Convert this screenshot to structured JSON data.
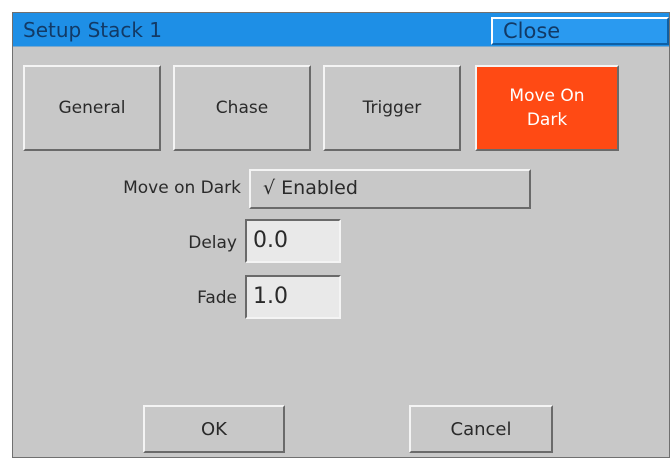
{
  "window": {
    "title": "Setup Stack 1",
    "close_label": "Close"
  },
  "tabs": [
    {
      "label": "General"
    },
    {
      "label": "Chase"
    },
    {
      "label": "Trigger"
    },
    {
      "label": "Move On Dark",
      "active": true
    }
  ],
  "move_on_dark": {
    "label": "Move on Dark",
    "value": "√ Enabled"
  },
  "delay": {
    "label": "Delay",
    "value": "0.0"
  },
  "fade": {
    "label": "Fade",
    "value": "1.0"
  },
  "buttons": {
    "ok": "OK",
    "cancel": "Cancel"
  },
  "colors": {
    "titlebar": "#1e8fe6",
    "active_tab": "#ff4a14",
    "panel": "#c8c8c8"
  }
}
